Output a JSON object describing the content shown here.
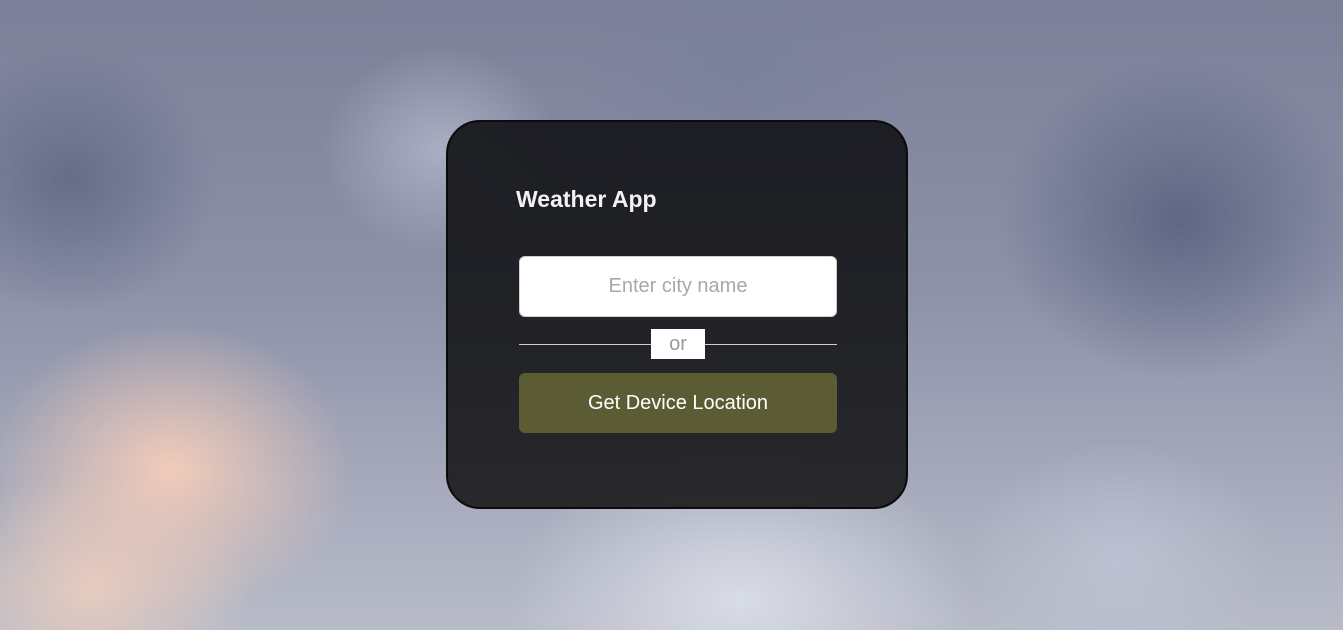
{
  "app": {
    "title": "Weather App"
  },
  "search": {
    "placeholder": "Enter city name",
    "value": ""
  },
  "divider": {
    "label": "or"
  },
  "location_button": {
    "label": "Get Device Location"
  },
  "colors": {
    "card_background": "#1b1c1f",
    "button_background": "#5c5c34",
    "button_text": "#ffffff",
    "title_text": "#f2f2f2",
    "placeholder_text": "#a8a8a8"
  }
}
